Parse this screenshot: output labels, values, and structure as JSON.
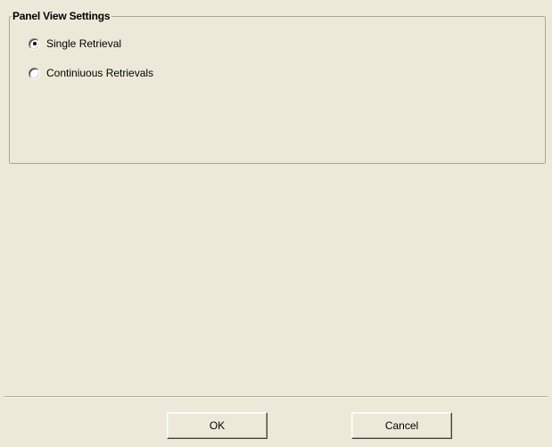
{
  "groupbox": {
    "title": "Panel View Settings",
    "options": [
      {
        "label": "Single Retrieval",
        "selected": true
      },
      {
        "label": "Continiuous Retrievals",
        "selected": false
      }
    ]
  },
  "buttons": {
    "ok_label": "OK",
    "cancel_label": "Cancel"
  }
}
